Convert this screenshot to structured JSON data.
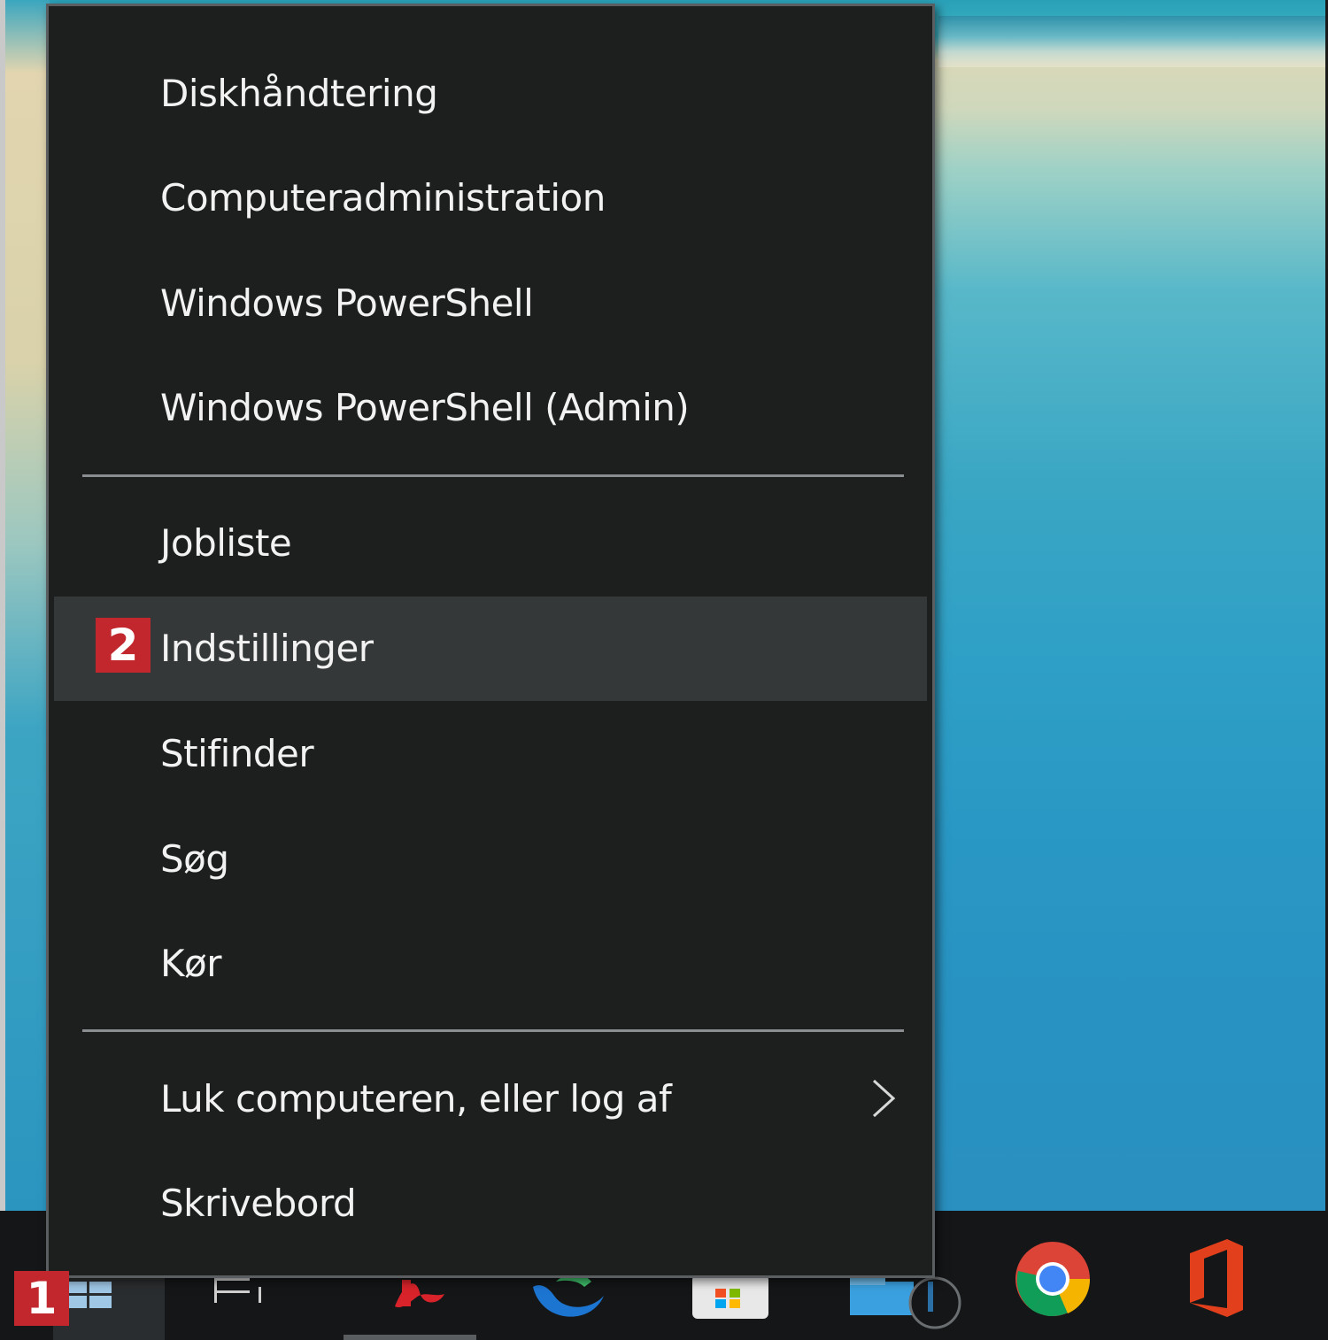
{
  "menu": {
    "items": [
      {
        "label": "Diskhåndtering"
      },
      {
        "label": "Computeradministration"
      },
      {
        "label": "Windows PowerShell"
      },
      {
        "label": "Windows PowerShell (Admin)"
      },
      {
        "label": "Jobliste"
      },
      {
        "label": "Indstillinger"
      },
      {
        "label": "Stifinder"
      },
      {
        "label": "Søg"
      },
      {
        "label": "Kør"
      },
      {
        "label": "Luk computeren, eller log af"
      },
      {
        "label": "Skrivebord"
      }
    ]
  },
  "badges": {
    "start": "1",
    "settings": "2"
  },
  "taskbar": {
    "icons": [
      "windows-start-icon",
      "task-view-icon",
      "acrobat-icon",
      "edge-icon",
      "store-icon",
      "file-explorer-icon",
      "clock-icon",
      "chrome-icon",
      "office-icon"
    ]
  },
  "colors": {
    "menu_bg": "#1d1f1f",
    "highlight_bg": "#353838",
    "badge_red": "#c1272d",
    "taskbar_bg": "#141617"
  }
}
